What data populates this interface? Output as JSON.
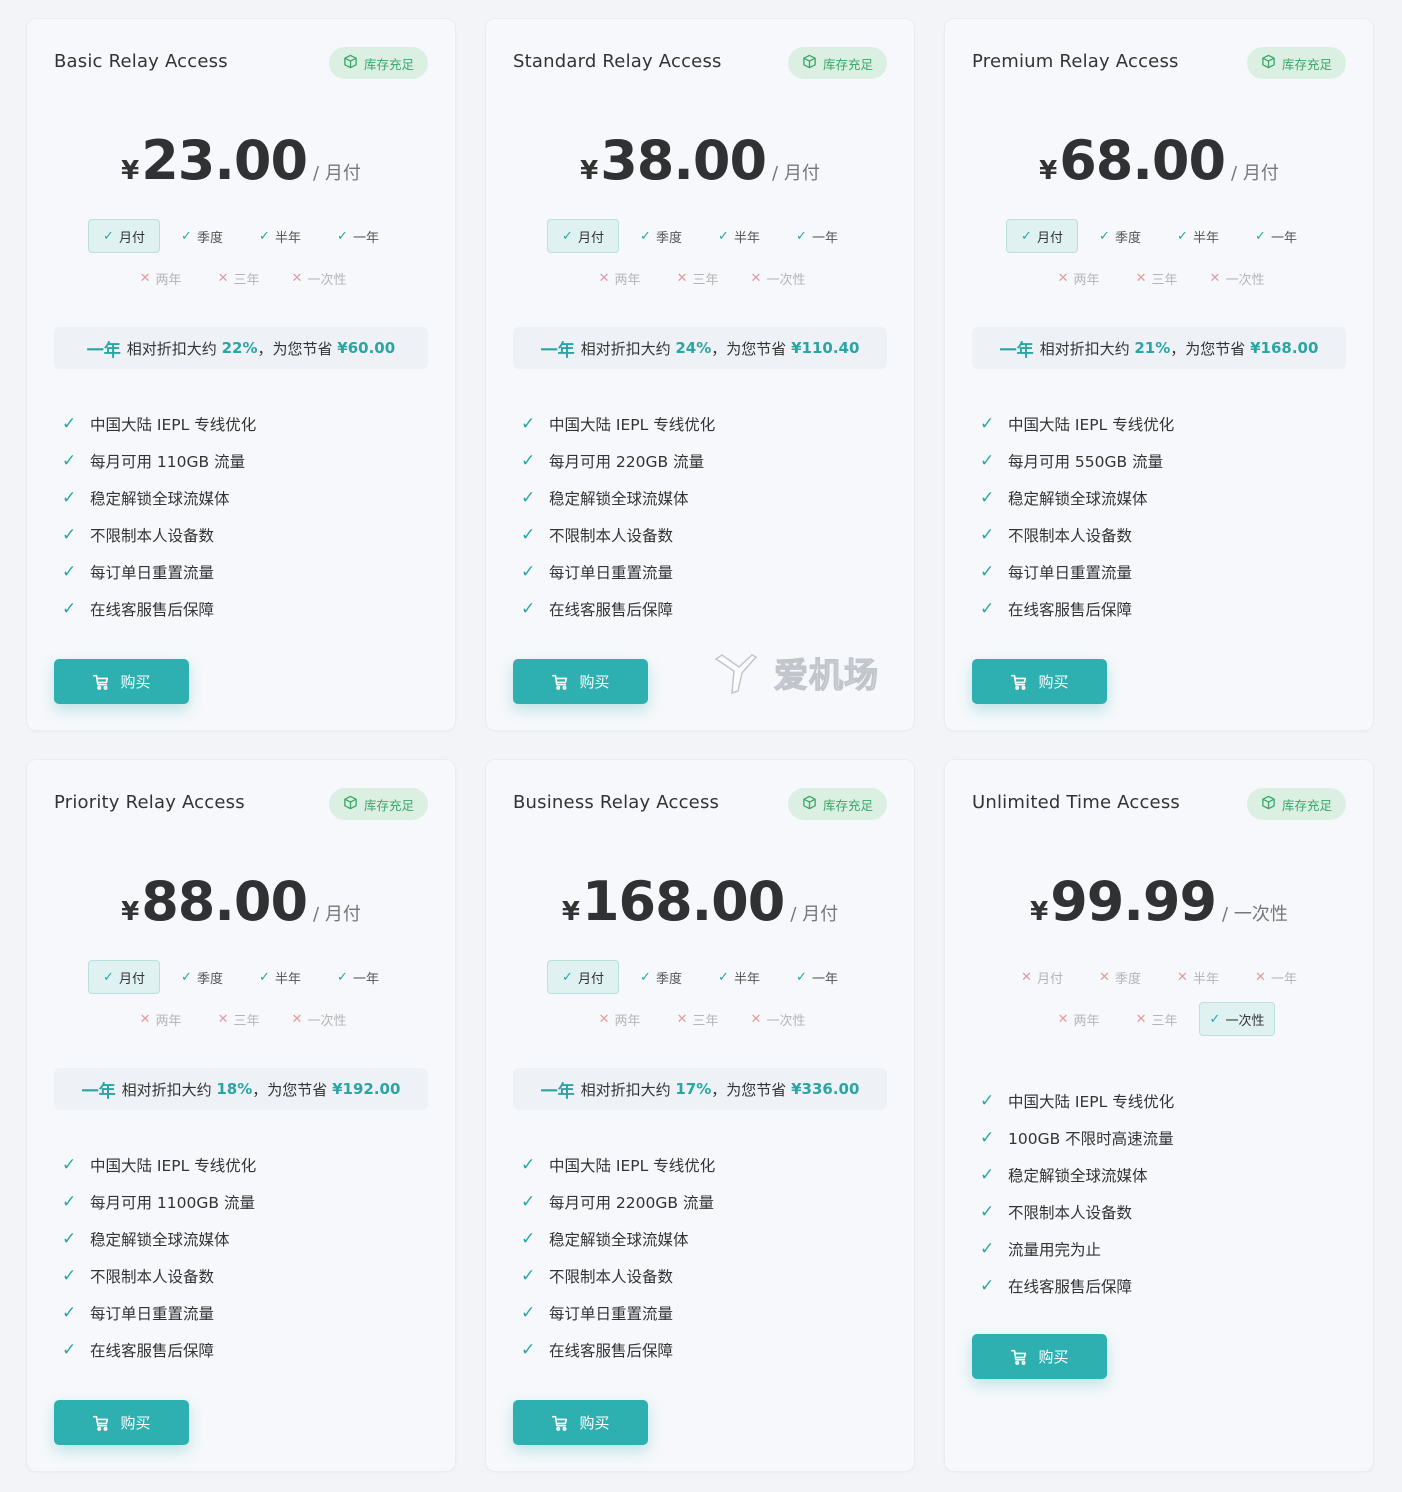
{
  "plans": [
    {
      "title": "Basic Relay Access",
      "badge": "库存充足",
      "currency": "¥",
      "price": "23.00",
      "period": "/ 月付",
      "options_row1": [
        {
          "label": "月付",
          "state": "sel"
        },
        {
          "label": "季度",
          "state": "ok"
        },
        {
          "label": "半年",
          "state": "ok"
        },
        {
          "label": "一年",
          "state": "ok"
        }
      ],
      "options_row2": [
        {
          "label": "两年",
          "state": "no"
        },
        {
          "label": "三年",
          "state": "no"
        },
        {
          "label": "一次性",
          "state": "no"
        }
      ],
      "discount": {
        "year": "一年",
        "text1": "相对折扣大约",
        "pct": "22%",
        "text2": "，为您节省",
        "save": "¥60.00"
      },
      "features": [
        "中国大陆 IEPL 专线优化",
        "每月可用 110GB 流量",
        "稳定解锁全球流媒体",
        "不限制本人设备数",
        "每订单日重置流量",
        "在线客服售后保障"
      ],
      "buy_label": "购买"
    },
    {
      "title": "Standard Relay Access",
      "badge": "库存充足",
      "currency": "¥",
      "price": "38.00",
      "period": "/ 月付",
      "options_row1": [
        {
          "label": "月付",
          "state": "sel"
        },
        {
          "label": "季度",
          "state": "ok"
        },
        {
          "label": "半年",
          "state": "ok"
        },
        {
          "label": "一年",
          "state": "ok"
        }
      ],
      "options_row2": [
        {
          "label": "两年",
          "state": "no"
        },
        {
          "label": "三年",
          "state": "no"
        },
        {
          "label": "一次性",
          "state": "no"
        }
      ],
      "discount": {
        "year": "一年",
        "text1": "相对折扣大约",
        "pct": "24%",
        "text2": "，为您节省",
        "save": "¥110.40"
      },
      "features": [
        "中国大陆 IEPL 专线优化",
        "每月可用 220GB 流量",
        "稳定解锁全球流媒体",
        "不限制本人设备数",
        "每订单日重置流量",
        "在线客服售后保障"
      ],
      "buy_label": "购买"
    },
    {
      "title": "Premium Relay Access",
      "badge": "库存充足",
      "currency": "¥",
      "price": "68.00",
      "period": "/ 月付",
      "options_row1": [
        {
          "label": "月付",
          "state": "sel"
        },
        {
          "label": "季度",
          "state": "ok"
        },
        {
          "label": "半年",
          "state": "ok"
        },
        {
          "label": "一年",
          "state": "ok"
        }
      ],
      "options_row2": [
        {
          "label": "两年",
          "state": "no"
        },
        {
          "label": "三年",
          "state": "no"
        },
        {
          "label": "一次性",
          "state": "no"
        }
      ],
      "discount": {
        "year": "一年",
        "text1": "相对折扣大约",
        "pct": "21%",
        "text2": "，为您节省",
        "save": "¥168.00"
      },
      "features": [
        "中国大陆 IEPL 专线优化",
        "每月可用 550GB 流量",
        "稳定解锁全球流媒体",
        "不限制本人设备数",
        "每订单日重置流量",
        "在线客服售后保障"
      ],
      "buy_label": "购买"
    },
    {
      "title": "Priority Relay Access",
      "badge": "库存充足",
      "currency": "¥",
      "price": "88.00",
      "period": "/ 月付",
      "options_row1": [
        {
          "label": "月付",
          "state": "sel"
        },
        {
          "label": "季度",
          "state": "ok"
        },
        {
          "label": "半年",
          "state": "ok"
        },
        {
          "label": "一年",
          "state": "ok"
        }
      ],
      "options_row2": [
        {
          "label": "两年",
          "state": "no"
        },
        {
          "label": "三年",
          "state": "no"
        },
        {
          "label": "一次性",
          "state": "no"
        }
      ],
      "discount": {
        "year": "一年",
        "text1": "相对折扣大约",
        "pct": "18%",
        "text2": "，为您节省",
        "save": "¥192.00"
      },
      "features": [
        "中国大陆 IEPL 专线优化",
        "每月可用 1100GB 流量",
        "稳定解锁全球流媒体",
        "不限制本人设备数",
        "每订单日重置流量",
        "在线客服售后保障"
      ],
      "buy_label": "购买"
    },
    {
      "title": "Business Relay Access",
      "badge": "库存充足",
      "currency": "¥",
      "price": "168.00",
      "period": "/ 月付",
      "options_row1": [
        {
          "label": "月付",
          "state": "sel"
        },
        {
          "label": "季度",
          "state": "ok"
        },
        {
          "label": "半年",
          "state": "ok"
        },
        {
          "label": "一年",
          "state": "ok"
        }
      ],
      "options_row2": [
        {
          "label": "两年",
          "state": "no"
        },
        {
          "label": "三年",
          "state": "no"
        },
        {
          "label": "一次性",
          "state": "no"
        }
      ],
      "discount": {
        "year": "一年",
        "text1": "相对折扣大约",
        "pct": "17%",
        "text2": "，为您节省",
        "save": "¥336.00"
      },
      "features": [
        "中国大陆 IEPL 专线优化",
        "每月可用 2200GB 流量",
        "稳定解锁全球流媒体",
        "不限制本人设备数",
        "每订单日重置流量",
        "在线客服售后保障"
      ],
      "buy_label": "购买"
    },
    {
      "title": "Unlimited Time Access",
      "badge": "库存充足",
      "currency": "¥",
      "price": "99.99",
      "period": "/ 一次性",
      "options_row1": [
        {
          "label": "月付",
          "state": "no"
        },
        {
          "label": "季度",
          "state": "no"
        },
        {
          "label": "半年",
          "state": "no"
        },
        {
          "label": "一年",
          "state": "no"
        }
      ],
      "options_row2": [
        {
          "label": "两年",
          "state": "no"
        },
        {
          "label": "三年",
          "state": "no"
        },
        {
          "label": "一次性",
          "state": "sel"
        }
      ],
      "discount": null,
      "features": [
        "中国大陆 IEPL 专线优化",
        "100GB 不限时高速流量",
        "稳定解锁全球流媒体",
        "不限制本人设备数",
        "流量用完为止",
        "在线客服售后保障"
      ],
      "buy_label": "购买"
    }
  ],
  "watermark": {
    "text": "爱机场"
  },
  "icons": {
    "badge": "cube-icon",
    "buy": "cart-icon",
    "ok": "check-icon",
    "no": "cross-icon"
  },
  "colors": {
    "accent": "#2fb0b0",
    "badge_bg": "#dcefe3",
    "badge_text": "#3aa66a",
    "no_mark": "#e59a9a"
  }
}
